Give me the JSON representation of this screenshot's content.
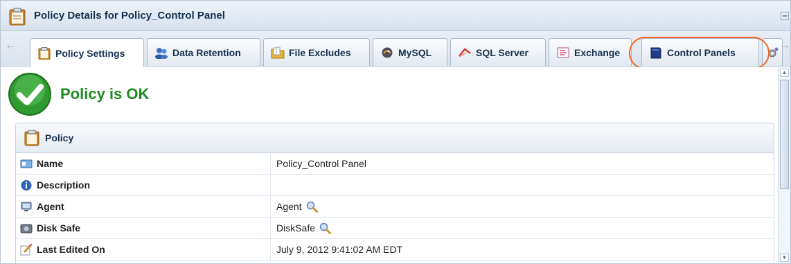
{
  "window": {
    "title": "Policy Details for Policy_Control Panel",
    "title_icon": "clipboard-icon"
  },
  "tabs": [
    {
      "label": "Policy Settings",
      "icon": "clipboard-icon",
      "active": true
    },
    {
      "label": "Data Retention",
      "icon": "database-users-icon",
      "active": false
    },
    {
      "label": "File Excludes",
      "icon": "folder-icon",
      "active": false
    },
    {
      "label": "MySQL",
      "icon": "mysql-icon",
      "active": false
    },
    {
      "label": "SQL Server",
      "icon": "sql-server-icon",
      "active": false
    },
    {
      "label": "Exchange",
      "icon": "exchange-icon",
      "active": false
    },
    {
      "label": "Control Panels",
      "icon": "control-panel-book-icon",
      "active": false,
      "highlighted": true
    }
  ],
  "status": {
    "text": "Policy is OK",
    "icon": "check-circle-icon",
    "color": "#1f8a22"
  },
  "panel": {
    "title": "Policy",
    "rows": [
      {
        "label": "Name",
        "value": "Policy_Control Panel",
        "icon": "name-card-icon"
      },
      {
        "label": "Description",
        "value": "",
        "icon": "info-icon"
      },
      {
        "label": "Agent",
        "value": "Agent",
        "icon": "computer-icon",
        "has_link_icon": true
      },
      {
        "label": "Disk Safe",
        "value": "DiskSafe",
        "icon": "disk-safe-icon",
        "has_link_icon": true
      },
      {
        "label": "Last Edited On",
        "value": "July 9, 2012 9:41:02 AM EDT",
        "icon": "edit-icon"
      }
    ]
  },
  "colors": {
    "highlight_ring": "#ec6a2c",
    "title_text": "#15304e",
    "status_green": "#1f8a22"
  }
}
